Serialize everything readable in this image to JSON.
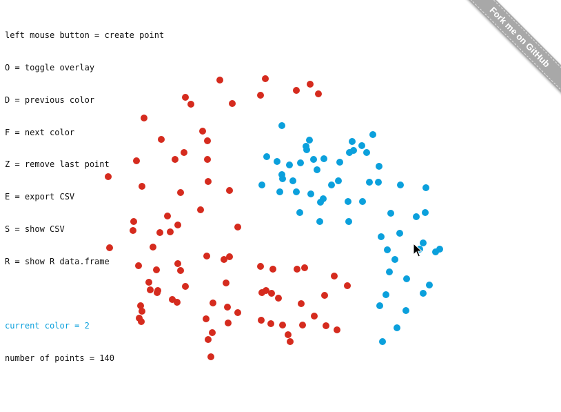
{
  "overlay": {
    "help_lines": [
      "left mouse button = create point",
      "O = toggle overlay",
      "D = previous color",
      "F = next color",
      "Z = remove last point",
      "E = export CSV",
      "S = show CSV",
      "R = show R data.frame"
    ],
    "current_color_text": "current color = 2",
    "point_count_text": "number of points = 140"
  },
  "ribbon": {
    "label": "Fork me on GitHub"
  },
  "colors": {
    "1": "#d52b1e",
    "2": "#0ba0dc",
    "ribbon": "#a8a8a8"
  },
  "chart_data": {
    "type": "scatter",
    "current_color": 2,
    "point_count": 140,
    "series": [
      {
        "color_id": 1,
        "points": [
          [
            319,
            116
          ],
          [
            385,
            114
          ],
          [
            450,
            122
          ],
          [
            462,
            136
          ],
          [
            430,
            131
          ],
          [
            378,
            138
          ],
          [
            269,
            141
          ],
          [
            277,
            151
          ],
          [
            337,
            150
          ],
          [
            209,
            171
          ],
          [
            294,
            190
          ],
          [
            234,
            202
          ],
          [
            301,
            204
          ],
          [
            267,
            221
          ],
          [
            254,
            231
          ],
          [
            301,
            231
          ],
          [
            198,
            233
          ],
          [
            157,
            256
          ],
          [
            206,
            270
          ],
          [
            302,
            263
          ],
          [
            262,
            279
          ],
          [
            333,
            276
          ],
          [
            291,
            304
          ],
          [
            243,
            313
          ],
          [
            194,
            321
          ],
          [
            258,
            326
          ],
          [
            193,
            334
          ],
          [
            232,
            337
          ],
          [
            247,
            336
          ],
          [
            345,
            329
          ],
          [
            222,
            358
          ],
          [
            159,
            359
          ],
          [
            300,
            371
          ],
          [
            333,
            372
          ],
          [
            325,
            376
          ],
          [
            201,
            385
          ],
          [
            258,
            382
          ],
          [
            227,
            391
          ],
          [
            262,
            392
          ],
          [
            378,
            386
          ],
          [
            396,
            390
          ],
          [
            431,
            390
          ],
          [
            442,
            388
          ],
          [
            485,
            400
          ],
          [
            216,
            409
          ],
          [
            269,
            415
          ],
          [
            229,
            421
          ],
          [
            218,
            420
          ],
          [
            228,
            424
          ],
          [
            328,
            410
          ],
          [
            504,
            414
          ],
          [
            380,
            424
          ],
          [
            386,
            421
          ],
          [
            394,
            425
          ],
          [
            404,
            432
          ],
          [
            250,
            434
          ],
          [
            257,
            438
          ],
          [
            309,
            439
          ],
          [
            330,
            445
          ],
          [
            437,
            440
          ],
          [
            471,
            428
          ],
          [
            204,
            443
          ],
          [
            345,
            453
          ],
          [
            206,
            451
          ],
          [
            202,
            461
          ],
          [
            205,
            466
          ],
          [
            299,
            462
          ],
          [
            379,
            464
          ],
          [
            393,
            469
          ],
          [
            410,
            471
          ],
          [
            439,
            471
          ],
          [
            456,
            458
          ],
          [
            473,
            472
          ],
          [
            489,
            478
          ],
          [
            331,
            468
          ],
          [
            308,
            482
          ],
          [
            418,
            485
          ],
          [
            302,
            492
          ],
          [
            421,
            495
          ],
          [
            306,
            517
          ]
        ]
      },
      {
        "color_id": 2,
        "points": [
          [
            409,
            182
          ],
          [
            541,
            195
          ],
          [
            449,
            203
          ],
          [
            444,
            212
          ],
          [
            511,
            205
          ],
          [
            525,
            211
          ],
          [
            445,
            217
          ],
          [
            513,
            218
          ],
          [
            507,
            221
          ],
          [
            532,
            221
          ],
          [
            387,
            227
          ],
          [
            402,
            234
          ],
          [
            420,
            239
          ],
          [
            436,
            236
          ],
          [
            455,
            231
          ],
          [
            470,
            230
          ],
          [
            493,
            235
          ],
          [
            460,
            246
          ],
          [
            550,
            241
          ],
          [
            409,
            253
          ],
          [
            410,
            259
          ],
          [
            425,
            262
          ],
          [
            380,
            268
          ],
          [
            491,
            262
          ],
          [
            481,
            268
          ],
          [
            536,
            264
          ],
          [
            549,
            264
          ],
          [
            581,
            268
          ],
          [
            618,
            272
          ],
          [
            406,
            278
          ],
          [
            430,
            278
          ],
          [
            451,
            281
          ],
          [
            469,
            288
          ],
          [
            465,
            293
          ],
          [
            505,
            292
          ],
          [
            526,
            292
          ],
          [
            435,
            308
          ],
          [
            567,
            309
          ],
          [
            604,
            314
          ],
          [
            617,
            308
          ],
          [
            464,
            321
          ],
          [
            506,
            321
          ],
          [
            580,
            338
          ],
          [
            553,
            343
          ],
          [
            614,
            352
          ],
          [
            562,
            362
          ],
          [
            609,
            361
          ],
          [
            638,
            361
          ],
          [
            632,
            365
          ],
          [
            573,
            376
          ],
          [
            565,
            394
          ],
          [
            590,
            404
          ],
          [
            623,
            413
          ],
          [
            560,
            427
          ],
          [
            614,
            425
          ],
          [
            551,
            443
          ],
          [
            589,
            450
          ],
          [
            576,
            475
          ],
          [
            555,
            495
          ]
        ]
      }
    ]
  }
}
